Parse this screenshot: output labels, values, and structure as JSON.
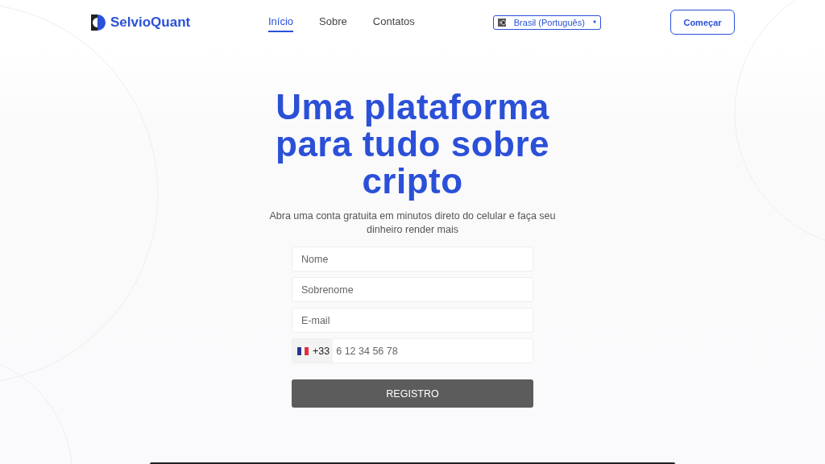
{
  "header": {
    "logo": "SelvioQuant",
    "nav": [
      {
        "label": "Início",
        "selected": true
      },
      {
        "label": "Sobre",
        "selected": false
      },
      {
        "label": "Contatos",
        "selected": false
      }
    ],
    "language": "Brasil (Português)",
    "cta": "Começar"
  },
  "hero": {
    "title": "Uma plataforma para tudo sobre cripto",
    "subtitle": "Abra uma conta gratuita em minutos direto do celular e faça seu dinheiro render mais",
    "fields": [
      {
        "placeholder": "Nome"
      },
      {
        "placeholder": "Sobrenome"
      },
      {
        "placeholder": "E-mail"
      }
    ],
    "phone": {
      "code": "+33",
      "placeholder": "6 12 34 56 78"
    },
    "submit": "REGISTRO"
  }
}
